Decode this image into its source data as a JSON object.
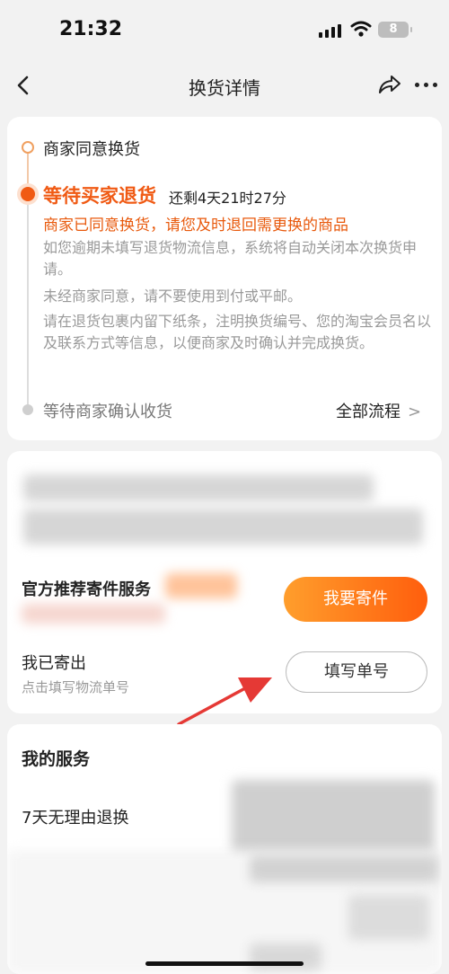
{
  "status_bar": {
    "time": "21:32",
    "battery": "8"
  },
  "nav": {
    "title": "换货详情",
    "back_icon": "chevron-left-icon",
    "share_icon": "share-icon",
    "more_icon": "more-icon"
  },
  "timeline": {
    "step1": "商家同意换货",
    "step2": "等待买家退货",
    "countdown": "还剩4天21时27分",
    "notice_main": "商家已同意换货，请您及时退回需更换的商品",
    "notices": [
      "如您逾期未填写退货物流信息，系统将自动关闭本次换货申请。",
      "未经商家同意，请不要使用到付或平邮。",
      "请在退货包裹内留下纸条，注明换货编号、您的淘宝会员名以及联系方式等信息，以便商家及时确认并完成换货。"
    ],
    "step3": "等待商家确认收货",
    "all_flow": "全部流程"
  },
  "shipping": {
    "official_label": "官方推荐寄件服务",
    "send_button": "我要寄件",
    "sent_label": "我已寄出",
    "sent_sub": "点击填写物流单号",
    "fill_button": "填写单号"
  },
  "services": {
    "title": "我的服务",
    "item": "7天无理由退换"
  },
  "colors": {
    "accent": "#f05a14",
    "button_gradient_start": "#ff9e2c",
    "button_gradient_end": "#ff5e0d"
  }
}
